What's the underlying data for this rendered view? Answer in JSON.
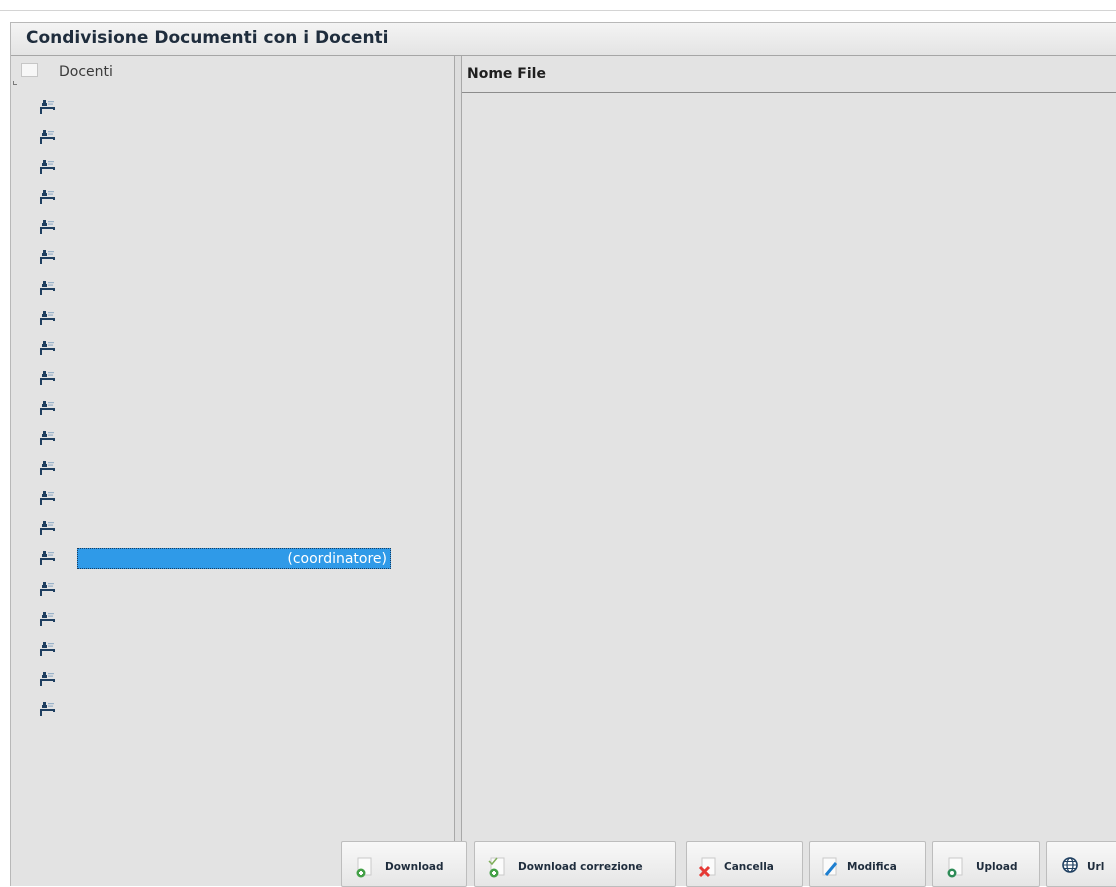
{
  "window": {
    "title": "Condivisione Documenti con i Docenti"
  },
  "tree": {
    "root_label": "Docenti",
    "rows": [
      {
        "label": ""
      },
      {
        "label": ""
      },
      {
        "label": ""
      },
      {
        "label": ""
      },
      {
        "label": ""
      },
      {
        "label": ""
      },
      {
        "label": ""
      },
      {
        "label": ""
      },
      {
        "label": ""
      },
      {
        "label": ""
      },
      {
        "label": ""
      },
      {
        "label": ""
      },
      {
        "label": ""
      },
      {
        "label": ""
      },
      {
        "label": ""
      },
      {
        "label": "(coordinatore)",
        "selected": true
      },
      {
        "label": ""
      },
      {
        "label": ""
      },
      {
        "label": ""
      },
      {
        "label": ""
      },
      {
        "label": ""
      }
    ]
  },
  "files": {
    "column_header": "Nome File"
  },
  "toolbar": {
    "download_label": "Download",
    "download_correzione_label": "Download correzione",
    "cancella_label": "Cancella",
    "modifica_label": "Modifica",
    "upload_label": "Upload",
    "url_label": "Url"
  },
  "colors": {
    "selection": "#2f9ae8",
    "panel_bg": "#e3e3e3",
    "title_text": "#1f2d3d"
  }
}
